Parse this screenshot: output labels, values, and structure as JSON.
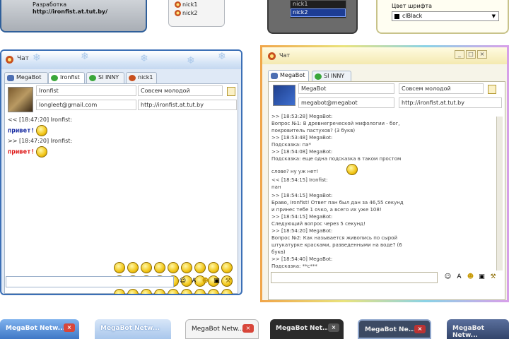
{
  "top_thumbs": {
    "t1_label": "Разработка",
    "t1_link": "http://ironfist.at.tut.by/",
    "t2_rows": [
      "nick1",
      "nick2"
    ],
    "t3_rows": [
      "nick1",
      "nick2"
    ],
    "t4_label": "Цвет шрифта",
    "t4_value": "clBlack"
  },
  "win1": {
    "title": "Чат",
    "tabs": [
      "MegaBot",
      "Ironfist",
      "SI INNY",
      "nick1"
    ],
    "nick_field": "Ironfist",
    "status_field": "Совсем молодой",
    "email_field": "longleet@gmail.com",
    "site_field": "http://ironfist.at.tut.by",
    "messages": [
      {
        "meta": "<< [18:47:20] Ironfist:",
        "text": "привет!"
      },
      {
        "meta": ">> [18:47:20] Ironfist:",
        "text": "привет!"
      }
    ]
  },
  "win2": {
    "title": "Чат",
    "tabs": [
      "MegaBot",
      "SI INNY"
    ],
    "nick_field": "MegaBot",
    "status_field": "Совсем молодой",
    "email_field": "megabot@megabot",
    "site_field": "http://ironfist.at.tut.by",
    "lines": [
      {
        "k": "meta",
        "t": ">> [18:53:28] MegaBot:"
      },
      {
        "k": "q",
        "t": "Вопрос №1: В древнегреческой мифологии - бог,"
      },
      {
        "k": "q",
        "t": "покровитель пастухов? (3 букв)"
      },
      {
        "k": "meta",
        "t": ">> [18:53:48] MegaBot:"
      },
      {
        "k": "q",
        "t": "Подсказка: па*"
      },
      {
        "k": "meta",
        "t": ">> [18:54:08] MegaBot:"
      },
      {
        "k": "q",
        "t": "Подсказка: еще одна подсказка в таком простом"
      },
      {
        "k": "q",
        "t": "слове? ну уж нет!"
      },
      {
        "k": "meta",
        "t": "<< [18:54:15] Ironfist:"
      },
      {
        "k": "r",
        "t": "пан"
      },
      {
        "k": "meta",
        "t": ">> [18:54:15] MegaBot:"
      },
      {
        "k": "q",
        "t": "Браво, Ironfist! Ответ пан был дан за 46,55 секунд"
      },
      {
        "k": "q",
        "t": "и принес тебе 1 очко, а всего их уже 108!"
      },
      {
        "k": "meta",
        "t": ">> [18:54:15] MegaBot:"
      },
      {
        "k": "q",
        "t": "Следующий вопрос через 5 секунд!"
      },
      {
        "k": "meta",
        "t": ">> [18:54:20] MegaBot:"
      },
      {
        "k": "q",
        "t": "Вопрос №2: Как называется живопись по сырой"
      },
      {
        "k": "q",
        "t": "штукатурке красками, разведенными на воде? (6"
      },
      {
        "k": "q",
        "t": "букв)"
      },
      {
        "k": "meta",
        "t": ">> [18:54:40] MegaBot:"
      },
      {
        "k": "q",
        "t": "Подсказка: **с***"
      }
    ]
  },
  "bottom_thumbs": [
    "MegaBot Netw...",
    "MegaBot Netw...",
    "MegaBot Netw...",
    "MegaBot Net...",
    "MegaBot Ne...",
    "MegaBot Netw..."
  ],
  "colors": {
    "win1_border": "#3b6fb6",
    "bot_text": "#1428a0",
    "user_text": "#d11111"
  }
}
